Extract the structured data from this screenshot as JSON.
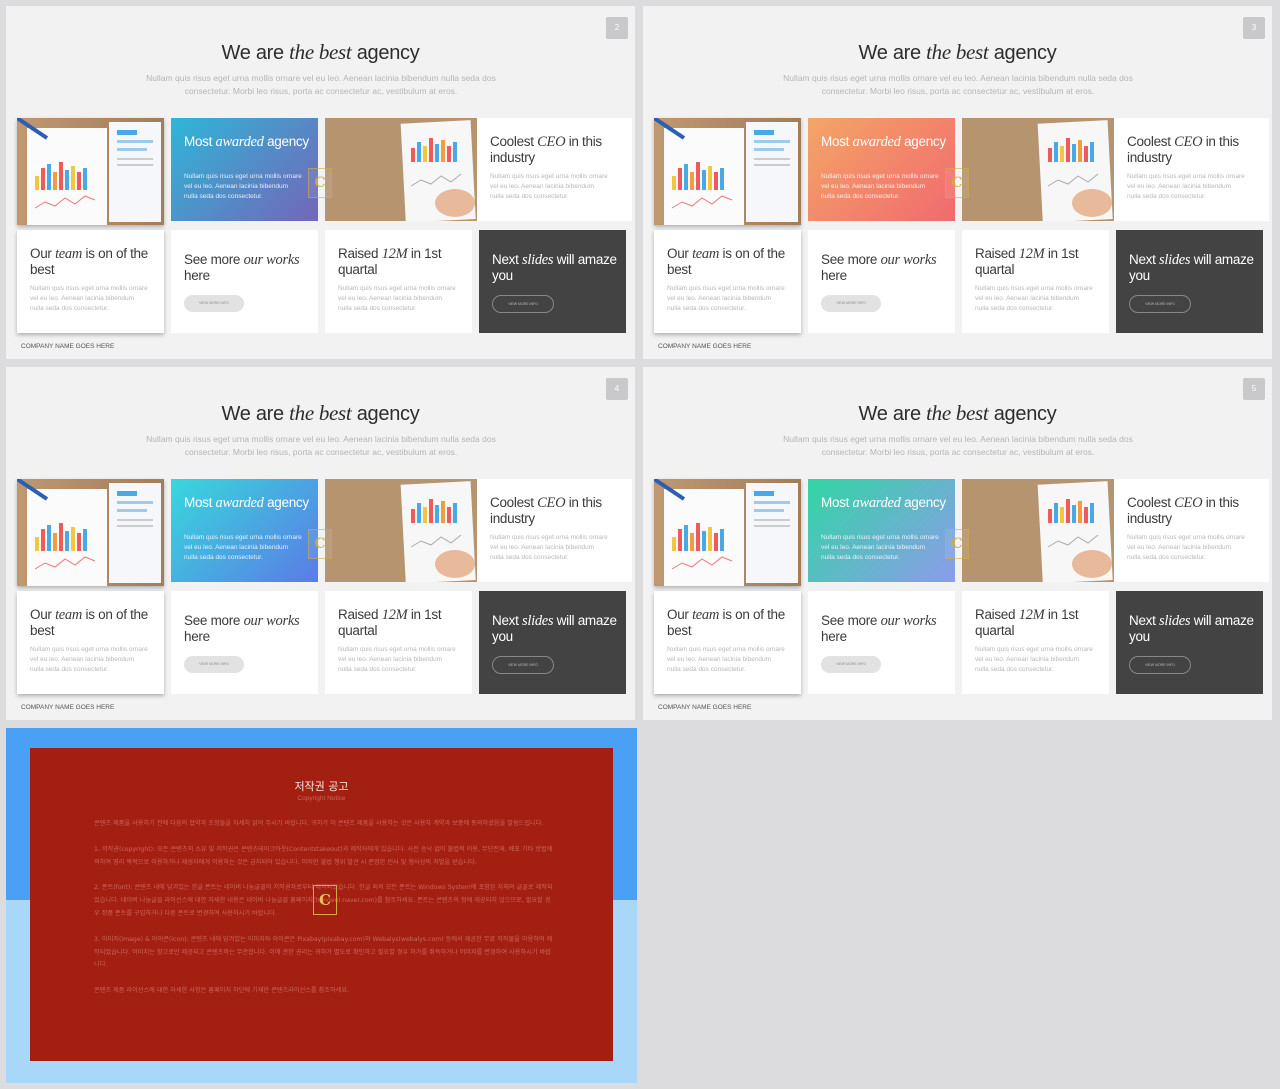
{
  "slides": [
    {
      "number": "2",
      "grad_from": "#2fb6d8",
      "grad_to": "#7466b8"
    },
    {
      "number": "3",
      "grad_from": "#f4a566",
      "grad_to": "#f06a6f"
    },
    {
      "number": "4",
      "grad_from": "#37d8dc",
      "grad_to": "#5b7be6"
    },
    {
      "number": "5",
      "grad_from": "#31d6a4",
      "grad_to": "#8d9bea"
    }
  ],
  "content": {
    "title_pre": "We are",
    "title_em": "the best",
    "title_post": "agency",
    "subtitle": "Nullam quis risus eget urna mollis ornare vel eu leo. Aenean lacinia bibendum nulla seda dos consectetur. Morbi leo risus, porta ac consectetur ac, vestibulum at eros.",
    "card_awarded": {
      "pre": "Most",
      "em": "awarded",
      "post": "agency"
    },
    "card_ceo": {
      "pre": "Coolest",
      "em": "CEO",
      "post": "in this industry"
    },
    "card_team": {
      "pre": "Our",
      "em": "team",
      "post": "is on of the best"
    },
    "card_works": {
      "pre": "See more",
      "em": "our works",
      "post": "here"
    },
    "card_raised": {
      "pre": "Raised",
      "em": "12M",
      "post": "in 1st quartal"
    },
    "card_next": {
      "pre": "Next",
      "em": "slides",
      "post": "will amaze you"
    },
    "body": "Nullam quis risus eget urna mollis ornare vel eu leo. Aenean lacinia bibendum nulla seda dos consectetur.",
    "button": "VIEW MORE INFO",
    "footer": "COMPANY NAME GOES HERE",
    "watermark": "C"
  },
  "notice": {
    "title": "저작권 공고",
    "subtitle": "Copyright Notice",
    "paragraphs": [
      "콘텐츠 제품을 사용하기 전에 다음의 협약과 조항들을 자세히 읽어 주시기 바랍니다. 귀하가 이 콘텐츠 제품을 사용하는 것은 사용자 계약과 보증에 동의하셨음을 말씀드립니다.",
      "1. 저작권(copyright): 모든 콘텐츠의 소유 및 저작권은 콘텐츠테이크아웃(Contentstakeout)과 제작자에게 있습니다. 사전 승낙 없이 불법적 이용, 무단전재, 배포 기타 방법에 의하여 영리 목적으로 이용하거나 재생자에게 이용하는 것은 금지되어 있습니다. 이러한 불법 행위 발견 시 준엄한 민사 및 형사상의 처벌을 받습니다.",
      "2. 폰트(font): 콘텐츠 내에 담겨있는 한글 폰트는 네이버 나눔글꼴의 저작권자로부터 제작되었습니다. 한글 외의 모든 폰트는 Windows System에 포함된 자체의 글꼴로 제작되었습니다. 네이버 나눔글꼴 라이선스에 대한 자세한 내용은 네이버 나눔글꼴 홈페이지(hangeul.naver.com)를 참조하세요. 폰트는 콘텐츠의 형에 재공되지 않으므로, 필요할 경우 정품 폰트를 구입하거나 다른 폰트로 변경하여 사용하시기 바랍니다.",
      "3. 이미지(image) & 아이콘(icon): 콘텐츠 내에 담겨있는 이미지와 아이콘은 Pixabay(pixabay.com)와 Webalys(webalys.com) 등에서 제공한 무료 저작물을 이용하여 제작되었습니다. 이미지는 참고로만 제공되고 콘텐츠와는 무관합니다. 이에 관한 권리는 귀하가 별도로 확인하고 필요할 경우 허가를 취득하거나 이미지를 변경하여 사용하시기 바랍니다.",
      "콘텐츠 제품 라이선스에 대한 자세한 사항은 홈페이지 하단에 기재한 콘텐츠라이선스를 참조하세요."
    ]
  }
}
